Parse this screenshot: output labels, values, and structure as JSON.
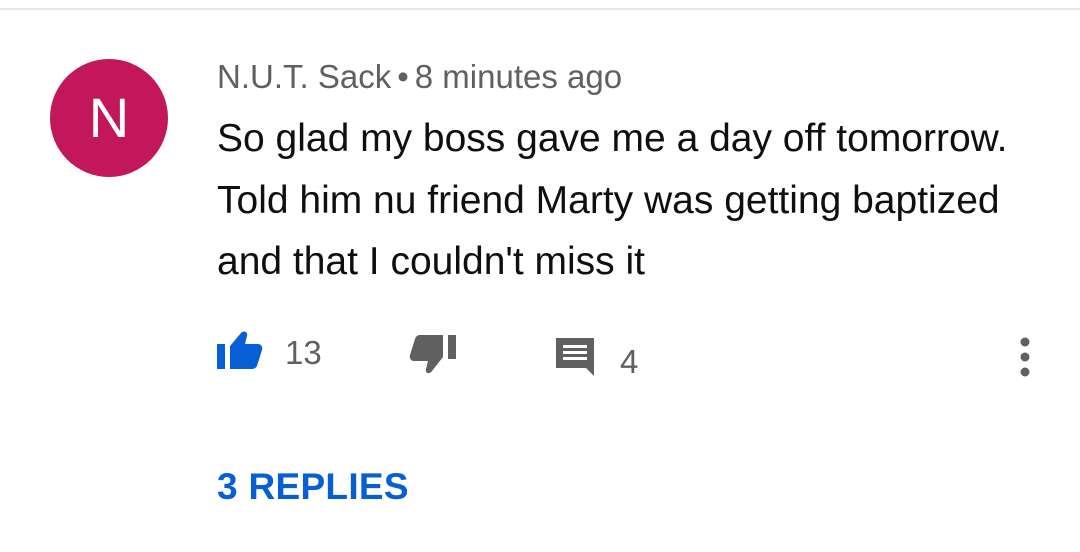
{
  "comment": {
    "author": "N.U.T. Sack",
    "separator": "•",
    "time": "8 minutes ago",
    "avatar_letter": "N",
    "avatar_color": "#c2185b",
    "text": "So glad my boss gave me a day off tomorrow. Told him nu friend Marty was getting baptized and that I couldn't miss it"
  },
  "actions": {
    "like_count": "13",
    "reply_count": "4",
    "liked": true,
    "like_icon": "thumbs-up-icon",
    "dislike_icon": "thumbs-down-icon",
    "reply_icon": "comment-icon",
    "more_icon": "more-vert-icon"
  },
  "replies_link": "3 REPLIES",
  "colors": {
    "accent": "#065fd4",
    "secondary_text": "#606060",
    "primary_text": "#0f0f0f",
    "icon_gray": "#606060"
  }
}
